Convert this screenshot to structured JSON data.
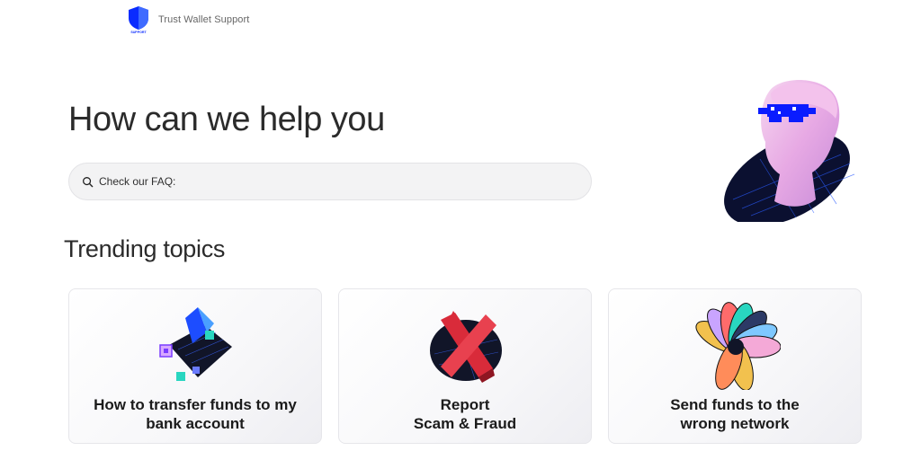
{
  "header": {
    "logo_icon": "shield-icon",
    "logo_badge": "SUPPORT",
    "logo_text": "Trust Wallet Support"
  },
  "hero": {
    "title": "How can we help you",
    "search": {
      "icon": "search-icon",
      "placeholder": "Check our FAQ:",
      "value": ""
    },
    "illustration": "statue-head-pixel-glasses"
  },
  "trending": {
    "title": "Trending topics",
    "cards": [
      {
        "label": "How to transfer funds to my\nbank account",
        "illustration": "wallet-cards-art"
      },
      {
        "label": "Report\nScam & Fraud",
        "illustration": "red-x-art"
      },
      {
        "label": "Send funds to the\nwrong network",
        "illustration": "coins-fan-art"
      }
    ]
  },
  "colors": {
    "brand_blue": "#0500ff",
    "page_bg": "#ffffff",
    "search_bg": "#f3f3f4",
    "card_border": "#e6e6ea",
    "text_dark": "#2b2b2b",
    "fraud_red": "#d92b3a"
  }
}
